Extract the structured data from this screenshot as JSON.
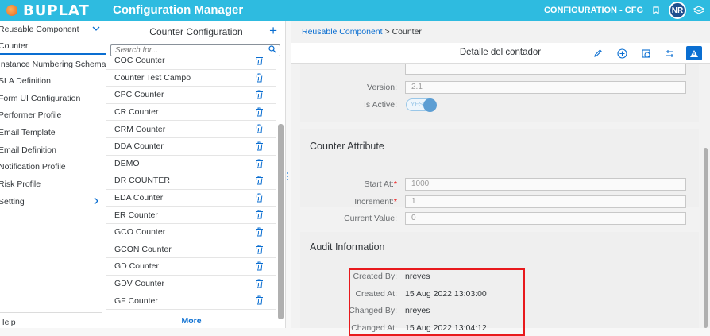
{
  "topbar": {
    "logo_text": "BUPLAT",
    "app_title": "Configuration Manager",
    "context": "CONFIGURATION - CFG",
    "avatar_initials": "NR",
    "bg_color": "#2ebbe0"
  },
  "nav": {
    "items": [
      {
        "label": "Reusable Component",
        "chevron": "chevron-down"
      },
      {
        "label": "Counter",
        "selected": true
      },
      {
        "label": "Instance Numbering Schema"
      },
      {
        "label": "SLA Definition"
      },
      {
        "label": "Form UI Configuration"
      },
      {
        "label": "Performer Profile"
      },
      {
        "label": "Email Template"
      },
      {
        "label": "Email Definition"
      },
      {
        "label": "Notification Profile"
      },
      {
        "label": "Risk Profile"
      },
      {
        "label": "Setting",
        "chevron": "chevron-right"
      }
    ],
    "help_label": "Help"
  },
  "counter_list": {
    "title": "Counter Configuration",
    "search_placeholder": "Search for...",
    "items": [
      "COC Counter",
      "Counter Test Campo",
      "CPC Counter",
      "CR Counter",
      "CRM Counter",
      "DDA Counter",
      "DEMO",
      "DR COUNTER",
      "EDA Counter",
      "ER Counter",
      "GCO Counter",
      "GCON Counter",
      "GD Counter",
      "GDV Counter",
      "GF Counter"
    ],
    "more_label": "More"
  },
  "detail": {
    "breadcrumb_link": "Reusable Component",
    "breadcrumb_sep": ">",
    "breadcrumb_current": "Counter",
    "title": "Detalle del contador",
    "version_label": "Version:",
    "version_value": "2.1",
    "active_label": "Is Active:",
    "active_value": "YES",
    "attr_section": "Counter Attribute",
    "start_label": "Start At:",
    "start_value": "1000",
    "increment_label": "Increment:",
    "increment_value": "1",
    "current_label": "Current Value:",
    "current_value": "0",
    "audit_section": "Audit Information",
    "created_by_label": "Created By:",
    "created_by_value": "nreyes",
    "created_at_label": "Created At:",
    "created_at_value": "15 Aug 2022 13:03:00",
    "changed_by_label": "Changed By:",
    "changed_by_value": "nreyes",
    "changed_at_label": "Changed At:",
    "changed_at_value": "15 Aug 2022 13:04:12"
  }
}
